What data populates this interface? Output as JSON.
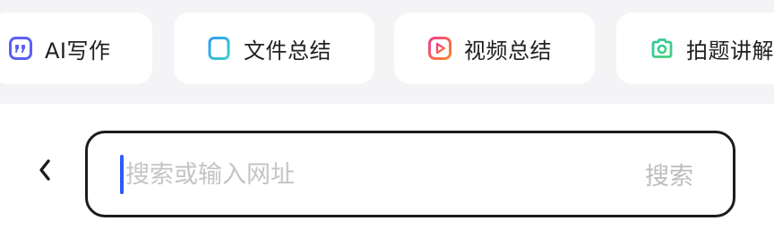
{
  "quick_actions": [
    {
      "label": "AI写作",
      "icon": "quote-icon",
      "color": "#5b5ff5"
    },
    {
      "label": "文件总结",
      "icon": "document-icon",
      "color": "#2bb5e6"
    },
    {
      "label": "视频总结",
      "icon": "video-play-icon",
      "color": "#f0447a"
    },
    {
      "label": "拍题讲解",
      "icon": "camera-icon",
      "color": "#36c98f"
    }
  ],
  "search": {
    "placeholder": "搜索或输入网址",
    "value": "",
    "button_label": "搜索"
  }
}
